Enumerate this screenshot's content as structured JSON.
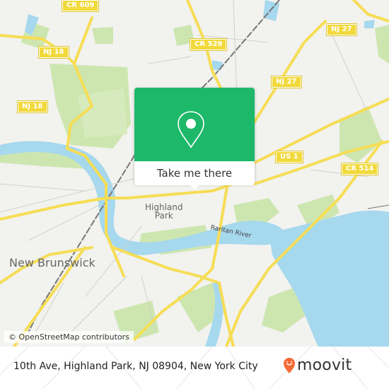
{
  "map": {
    "attribution": "© OpenStreetMap contributors",
    "colors": {
      "land": "#f2f2ef",
      "park": "#cde6b0",
      "water": "#a6d8ee",
      "road": "#f6dd55",
      "rail": "#777777",
      "popup_accent": "#1eb86b"
    },
    "route_shields": [
      {
        "label": "CR 609"
      },
      {
        "label": "NJ 18"
      },
      {
        "label": "NJ 18"
      },
      {
        "label": "CR 529"
      },
      {
        "label": "NJ 27"
      },
      {
        "label": "NJ 27"
      },
      {
        "label": "US 1"
      },
      {
        "label": "CR 514"
      }
    ],
    "place_labels": {
      "highland_park_line1": "Highland",
      "highland_park_line2": "Park",
      "new_brunswick": "New Brunswick"
    },
    "river_label": "Raritan River"
  },
  "popup": {
    "icon": "location-pin-icon",
    "button_label": "Take me there"
  },
  "footer": {
    "address": "10th Ave, Highland Park, NJ 08904, New York City",
    "brand": "moovit",
    "brand_color": "#f26a36"
  }
}
